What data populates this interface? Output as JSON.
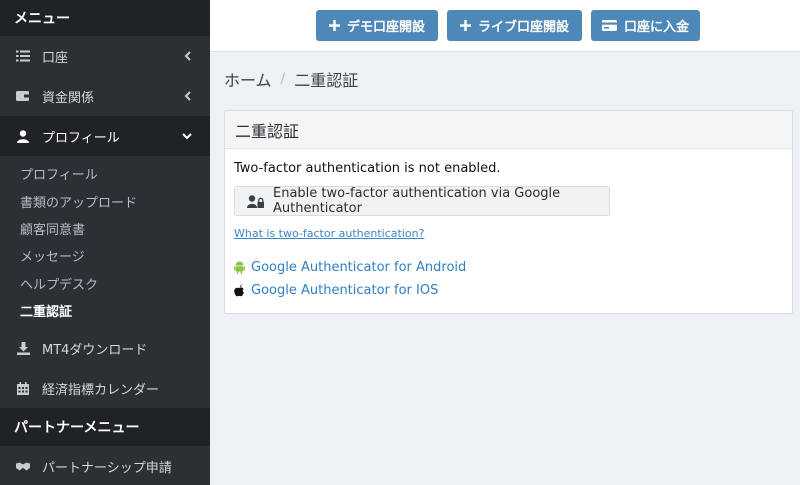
{
  "sidebar": {
    "menu_title": "メニュー",
    "items": [
      {
        "label": "口座"
      },
      {
        "label": "資金関係"
      },
      {
        "label": "プロフィール"
      }
    ],
    "profile_submenu": [
      {
        "label": "プロフィール"
      },
      {
        "label": "書類のアップロード"
      },
      {
        "label": "顧客同意書"
      },
      {
        "label": "メッセージ"
      },
      {
        "label": "ヘルプデスク"
      },
      {
        "label": "二重認証"
      }
    ],
    "lower_items": [
      {
        "label": "MT4ダウンロード"
      },
      {
        "label": "経済指標カレンダー"
      }
    ],
    "partner_title": "パートナーメニュー",
    "partner_items": [
      {
        "label": "パートナーシップ申請"
      }
    ]
  },
  "toolbar": {
    "demo_label": "デモ口座開設",
    "live_label": "ライブ口座開設",
    "deposit_label": "口座に入金"
  },
  "breadcrumb": {
    "home": "ホーム",
    "separator": "/",
    "current": "二重認証"
  },
  "panel": {
    "title": "二重認証",
    "status_text": "Two-factor authentication is not enabled.",
    "enable_button": "Enable two-factor authentication via Google Authenticator",
    "what_link": "What is two-factor authentication?",
    "android_link": "Google Authenticator for Android",
    "ios_link": "Google Authenticator for IOS"
  },
  "colors": {
    "sidebar_bg": "#2b3035",
    "sidebar_dark": "#1f2327",
    "primary_button": "#4e88b8",
    "link": "#2f7fc1",
    "android_green": "#8bc34a"
  }
}
